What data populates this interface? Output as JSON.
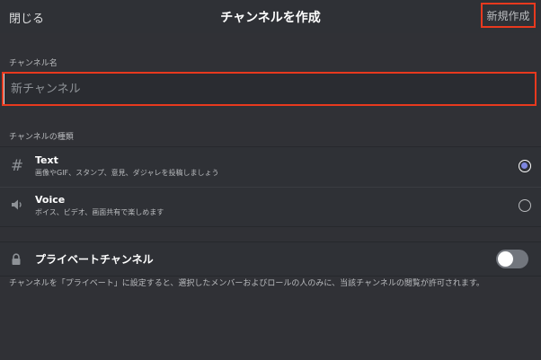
{
  "header": {
    "close_label": "閉じる",
    "title": "チャンネルを作成",
    "create_label": "新規作成"
  },
  "channel_name": {
    "section_label": "チャンネル名",
    "placeholder": "新チャンネル",
    "value": ""
  },
  "channel_type": {
    "section_label": "チャンネルの種類",
    "options": [
      {
        "name": "Text",
        "description": "画像やGIF、スタンプ、意見、ダジャレを投稿しましょう",
        "icon": "hash-icon",
        "selected": true
      },
      {
        "name": "Voice",
        "description": "ボイス、ビデオ、画面共有で楽しめます",
        "icon": "speaker-icon",
        "selected": false
      }
    ]
  },
  "private_channel": {
    "label": "プライベートチャンネル",
    "icon": "lock-icon",
    "enabled": false,
    "description": "チャンネルを「プライベート」に設定すると、選択したメンバーおよびロールの人のみに、当該チャンネルの閲覧が許可されます。"
  },
  "colors": {
    "background": "#303136",
    "highlight_border": "#e8391e",
    "radio_selected": "#7d86e0"
  }
}
